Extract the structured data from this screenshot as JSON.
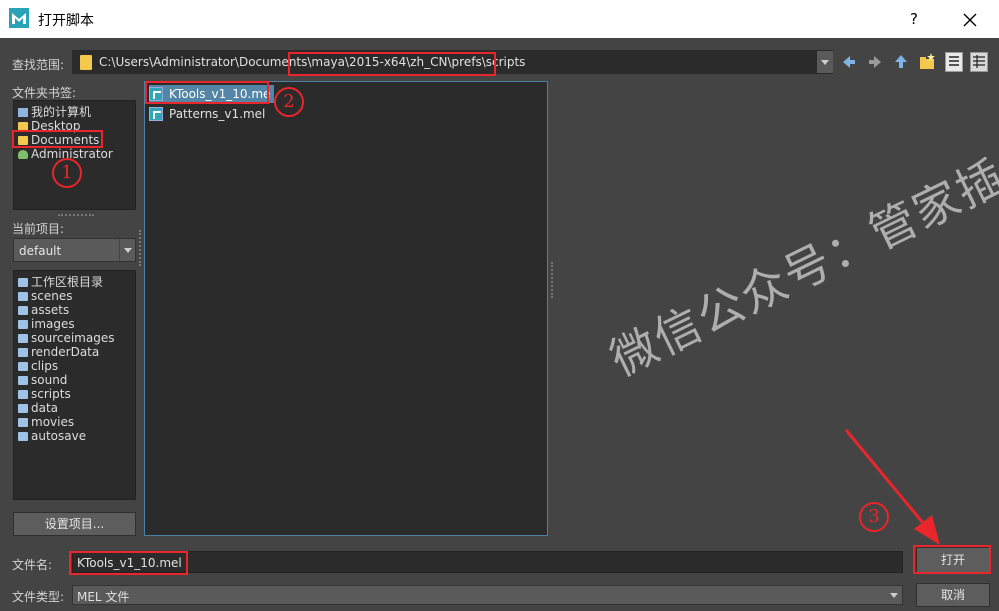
{
  "window": {
    "title": "打开脚本",
    "help_label": "?"
  },
  "look_in": {
    "label": "查找范围:",
    "path": "C:\\Users\\Administrator\\Documents\\maya\\2015-x64\\zh_CN\\prefs\\scripts"
  },
  "bookmarks": {
    "label": "文件夹书签:",
    "items": [
      {
        "label": "我的计算机",
        "icon": "computer-icon"
      },
      {
        "label": "Desktop",
        "icon": "folder-icon"
      },
      {
        "label": "Documents",
        "icon": "folder-icon"
      },
      {
        "label": "Administrator",
        "icon": "user-icon"
      }
    ]
  },
  "project": {
    "label": "当前项目:",
    "value": "default"
  },
  "project_folders": [
    "工作区根目录",
    "scenes",
    "assets",
    "images",
    "sourceimages",
    "renderData",
    "clips",
    "sound",
    "scripts",
    "data",
    "movies",
    "autosave"
  ],
  "set_project_label": "设置项目...",
  "files": [
    {
      "name": "KTools_v1_10.me",
      "selected": true
    },
    {
      "name": "Patterns_v1.mel",
      "selected": false
    }
  ],
  "filename": {
    "label": "文件名:",
    "value": "KTools_v1_10.mel"
  },
  "filetype": {
    "label": "文件类型:",
    "value": "MEL 文件"
  },
  "buttons": {
    "open": "打开",
    "cancel": "取消"
  },
  "annotations": {
    "step1": "1",
    "step2": "2",
    "step3": "3"
  },
  "watermark": "微信公众号：管家插件",
  "colors": {
    "annotation_red": "#e8262b",
    "selection_blue": "#5285a6",
    "dialog_bg": "#444444"
  }
}
